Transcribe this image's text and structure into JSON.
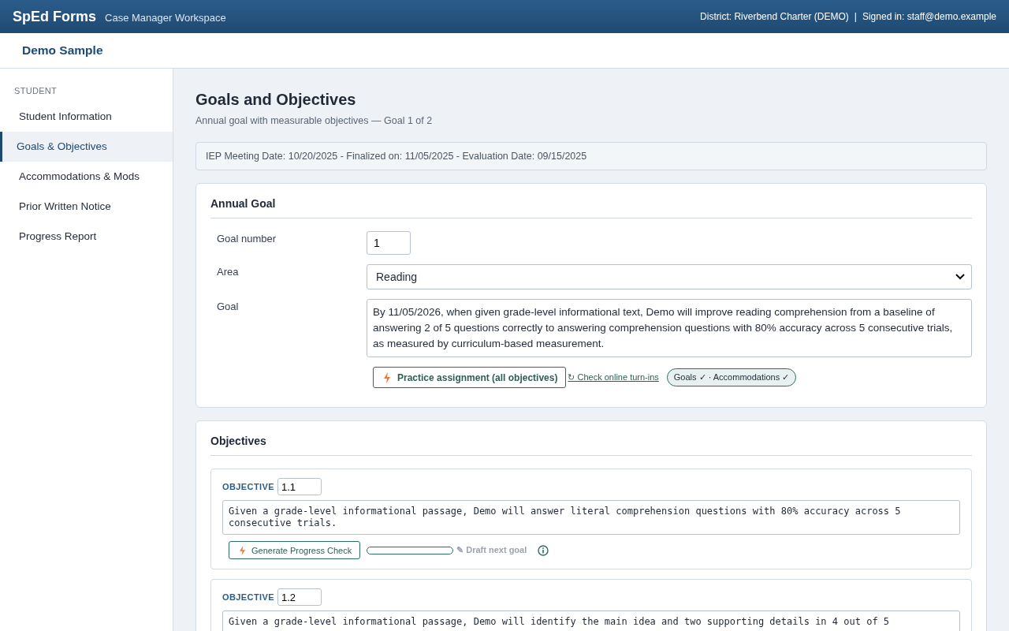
{
  "header": {
    "brand": "SpEd Forms",
    "subtitle": "Case Manager Workspace",
    "district": "District: Riverbend Charter (DEMO)",
    "separator": "|",
    "signed_in": "Signed in: staff@demo.example"
  },
  "student_name": "Demo Sample",
  "sidebar": {
    "section": "STUDENT",
    "items": [
      {
        "label": "Student Information",
        "selected": false
      },
      {
        "label": "Goals & Objectives",
        "selected": true
      },
      {
        "label": "Accommodations & Mods",
        "selected": false
      },
      {
        "label": "Prior Written Notice",
        "selected": false
      },
      {
        "label": "Progress Report",
        "selected": false
      }
    ]
  },
  "page": {
    "title": "Goals and Objectives",
    "subtitle": "Annual goal with measurable objectives — Goal 1 of 2",
    "dates": "IEP Meeting Date: 10/20/2025 - Finalized on: 11/05/2025 - Evaluation Date: 09/15/2025"
  },
  "annual_goal": {
    "heading": "Annual Goal",
    "fields": [
      {
        "kind": "input",
        "label": "Goal number",
        "value": "1"
      },
      {
        "kind": "select",
        "label": "Area",
        "value": "Reading"
      },
      {
        "kind": "textarea",
        "label": "Goal",
        "value": "By 11/05/2026, when given grade-level informational text, Demo will improve reading comprehension from a baseline of answering 2 of 5 questions correctly to answering comprehension questions with 80% accuracy across 5 consecutive trials, as measured by curriculum-based measurement."
      }
    ],
    "practice_button": "Practice assignment (all objectives)",
    "check_link": "↻ Check online turn-ins",
    "status_badge": "Goals ✓ · Accommodations ✓"
  },
  "objectives": {
    "heading": "Objectives",
    "items": [
      {
        "label": "OBJECTIVE",
        "number": "1.1",
        "text": "Given a grade-level informational passage, Demo will answer literal comprehension questions with 80% accuracy across 5 consecutive trials.",
        "button": "Generate Progress Check",
        "level": 0,
        "draft": "✎ Draft next goal",
        "draft_disabled": true
      },
      {
        "label": "OBJECTIVE",
        "number": "1.2",
        "text": "Given a grade-level informational passage, Demo will identify the main idea and two supporting details in 4 out of 5"
      }
    ]
  }
}
